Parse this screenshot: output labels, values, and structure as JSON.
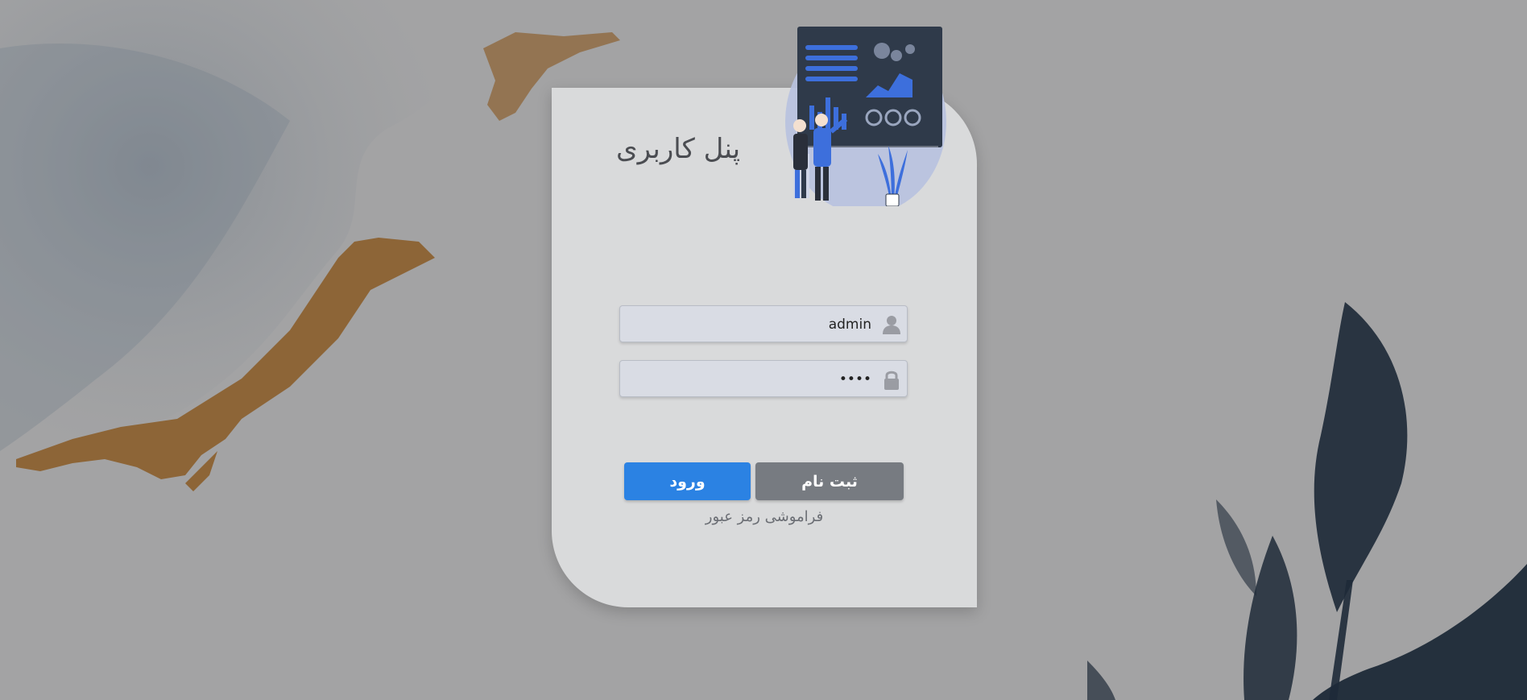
{
  "panel": {
    "title": "پنل کاربری"
  },
  "form": {
    "username_value": "admin",
    "password_value": "1234"
  },
  "buttons": {
    "login_label": "ورود",
    "register_label": "ثبت نام"
  },
  "links": {
    "forgot_password_label": "فراموشی رمز عبور"
  },
  "icons": {
    "username": "user-icon",
    "password": "lock-icon"
  },
  "colors": {
    "login_button": "#2b82e3",
    "register_button": "#777b81",
    "card_background": "#dddee0",
    "illustration_accent": "#3d6fdc"
  }
}
